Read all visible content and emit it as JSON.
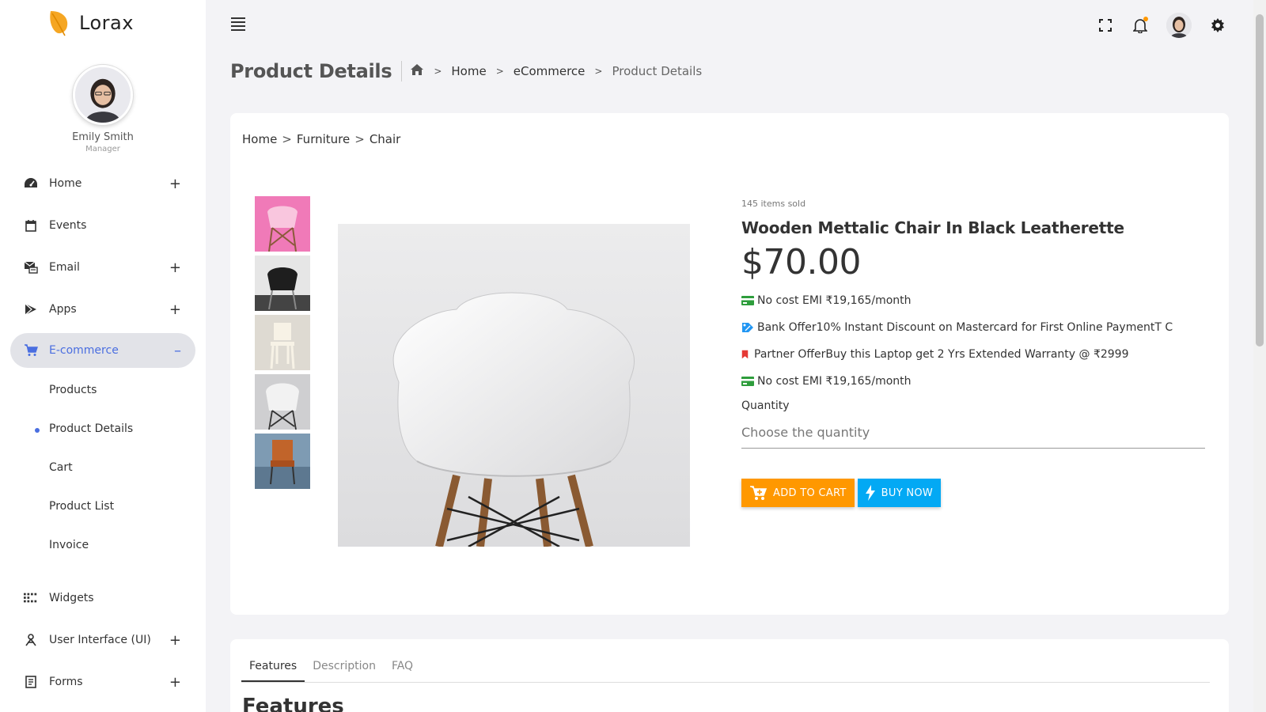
{
  "brand": {
    "name": "Lorax"
  },
  "profile": {
    "name": "Emily Smith",
    "role": "Manager"
  },
  "sidebar": {
    "items": [
      {
        "label": "Home",
        "icon": "dashboard-icon",
        "expand": "+"
      },
      {
        "label": "Events",
        "icon": "calendar-icon",
        "expand": ""
      },
      {
        "label": "Email",
        "icon": "email-icon",
        "expand": "+"
      },
      {
        "label": "Apps",
        "icon": "apps-icon",
        "expand": "+"
      },
      {
        "label": "E-commerce",
        "icon": "cart-icon",
        "expand": "–"
      },
      {
        "label": "Widgets",
        "icon": "widgets-icon",
        "expand": ""
      },
      {
        "label": "User Interface (UI)",
        "icon": "user-interface-icon",
        "expand": "+"
      },
      {
        "label": "Forms",
        "icon": "forms-icon",
        "expand": "+"
      }
    ],
    "ecommerce_sub": [
      "Products",
      "Product Details",
      "Cart",
      "Product List",
      "Invoice"
    ]
  },
  "header": {
    "title": "Product Details",
    "breadcrumb": [
      "Home",
      "eCommerce",
      "Product Details"
    ]
  },
  "product": {
    "breadcrumb": [
      "Home",
      "Furniture",
      "Chair"
    ],
    "sold": "145 items sold",
    "title": "Wooden Mettalic Chair In Black Leatherette",
    "price": "$70.00",
    "offers": [
      {
        "icon": "credit-card-icon",
        "text": "No cost EMI ₹19,165/month"
      },
      {
        "icon": "bank-offer-icon",
        "text": "Bank Offer10% Instant Discount on Mastercard for First Online PaymentT C"
      },
      {
        "icon": "bookmark-icon",
        "text": "Partner OfferBuy this Laptop   get 2 Yrs Extended Warranty @ ₹2999"
      },
      {
        "icon": "credit-card-icon",
        "text": "No cost EMI ₹19,165/month"
      }
    ],
    "quantity_label": "Quantity",
    "quantity_placeholder": "Choose the quantity",
    "add_to_cart": "ADD TO CART",
    "buy_now": "BUY NOW"
  },
  "tabs": {
    "items": [
      "Features",
      "Description",
      "FAQ"
    ],
    "heading": "Features"
  },
  "colors": {
    "accent": "#4a6ee0",
    "cart_button": "#ff9800",
    "buy_button": "#03a9f4",
    "brand_leaf": "#f5a623"
  }
}
